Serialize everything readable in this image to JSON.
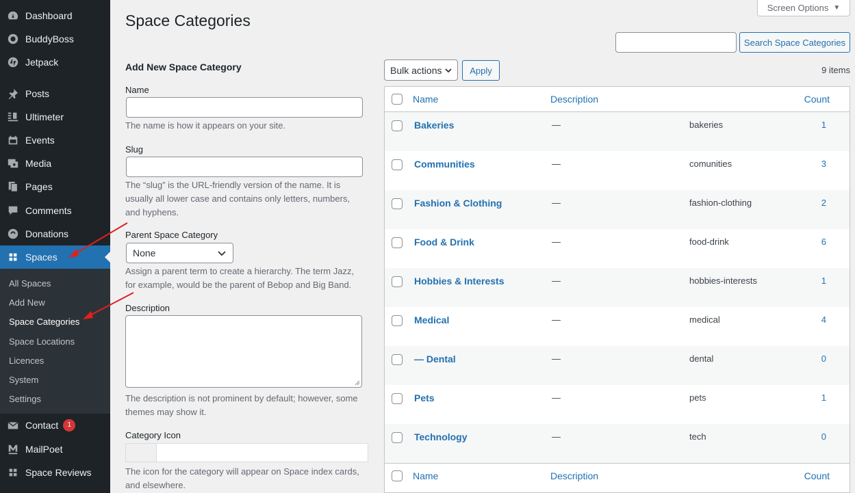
{
  "sidebar": {
    "items": [
      {
        "label": "Dashboard",
        "icon": "dashboard-icon"
      },
      {
        "label": "BuddyBoss",
        "icon": "buddyboss-icon"
      },
      {
        "label": "Jetpack",
        "icon": "jetpack-icon"
      },
      {
        "label": "Posts",
        "icon": "pin-icon"
      },
      {
        "label": "Ultimeter",
        "icon": "ultimeter-icon"
      },
      {
        "label": "Events",
        "icon": "calendar-icon"
      },
      {
        "label": "Media",
        "icon": "media-icon"
      },
      {
        "label": "Pages",
        "icon": "pages-icon"
      },
      {
        "label": "Comments",
        "icon": "comment-icon"
      },
      {
        "label": "Donations",
        "icon": "donations-icon"
      },
      {
        "label": "Spaces",
        "icon": "spaces-icon"
      },
      {
        "label": "Contact",
        "icon": "envelope-icon",
        "badge": "1"
      },
      {
        "label": "MailPoet",
        "icon": "mailpoet-icon"
      },
      {
        "label": "Space Reviews",
        "icon": "reviews-icon"
      }
    ],
    "submenu": [
      "All Spaces",
      "Add New",
      "Space Categories",
      "Space Locations",
      "Licences",
      "System",
      "Settings"
    ]
  },
  "header": {
    "screen_options": "Screen Options",
    "title": "Space Categories",
    "search_button": "Search Space Categories",
    "search_value": ""
  },
  "form": {
    "heading": "Add New Space Category",
    "name_label": "Name",
    "name_help": "The name is how it appears on your site.",
    "slug_label": "Slug",
    "slug_help": "The “slug” is the URL-friendly version of the name. It is usually all lower case and contains only letters, numbers, and hyphens.",
    "parent_label": "Parent Space Category",
    "parent_value": "None",
    "parent_help": "Assign a parent term to create a hierarchy. The term Jazz, for example, would be the parent of Bebop and Big Band.",
    "description_label": "Description",
    "description_help": "The description is not prominent by default; however, some themes may show it.",
    "icon_label": "Category Icon",
    "icon_help": "The icon for the category will appear on Space index cards, and elsewhere."
  },
  "table": {
    "bulk_actions": "Bulk actions",
    "apply": "Apply",
    "items_count": "9 items",
    "columns": {
      "name": "Name",
      "description": "Description",
      "count": "Count"
    },
    "rows": [
      {
        "name": "Bakeries",
        "description": "—",
        "slug": "bakeries",
        "count": "1"
      },
      {
        "name": "Communities",
        "description": "—",
        "slug": "comunities",
        "count": "3"
      },
      {
        "name": "Fashion & Clothing",
        "description": "—",
        "slug": "fashion-clothing",
        "count": "2"
      },
      {
        "name": "Food & Drink",
        "description": "—",
        "slug": "food-drink",
        "count": "6"
      },
      {
        "name": "Hobbies & Interests",
        "description": "—",
        "slug": "hobbies-interests",
        "count": "1"
      },
      {
        "name": "Medical",
        "description": "—",
        "slug": "medical",
        "count": "4"
      },
      {
        "name": "— Dental",
        "description": "—",
        "slug": "dental",
        "count": "0"
      },
      {
        "name": "Pets",
        "description": "—",
        "slug": "pets",
        "count": "1"
      },
      {
        "name": "Technology",
        "description": "—",
        "slug": "tech",
        "count": "0"
      }
    ]
  },
  "colors": {
    "accent": "#2271b1",
    "sidebar": "#1d2327",
    "annotation_arrow": "#e0201f"
  }
}
